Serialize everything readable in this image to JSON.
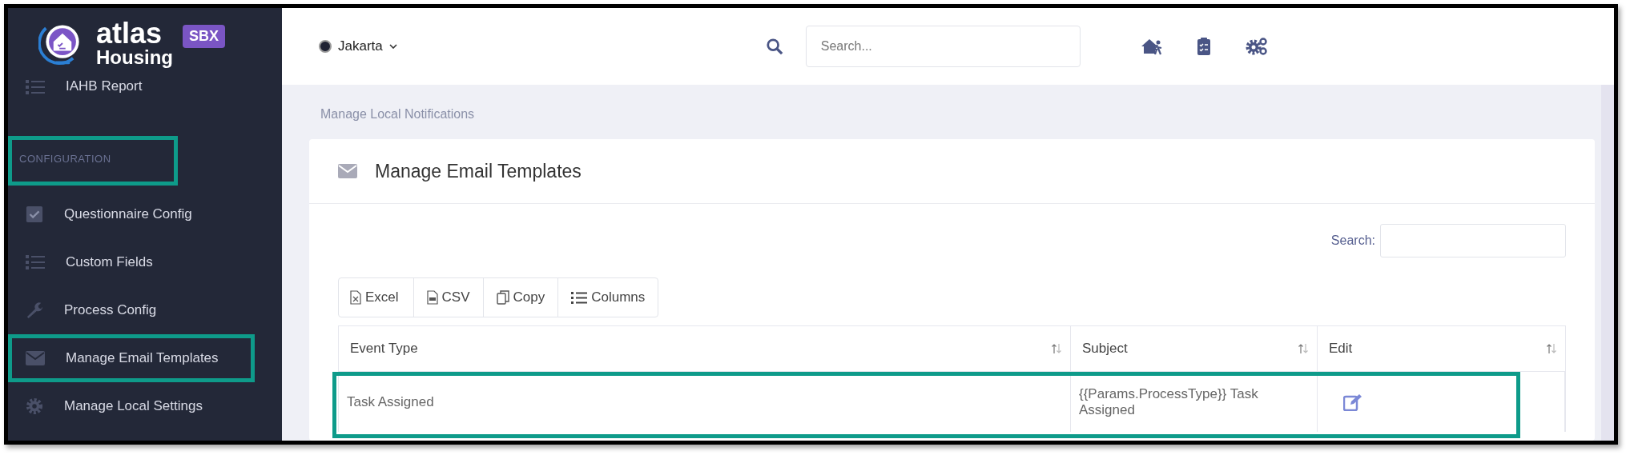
{
  "brand": {
    "name": "atlas",
    "sub": "Housing",
    "badge": "SBX"
  },
  "sidebar": {
    "items": [
      {
        "label": "IAHB Report",
        "kind": "list",
        "highlighted": false
      }
    ],
    "section": {
      "label": "CONFIGURATION",
      "highlighted": true
    },
    "config_items": [
      {
        "label": "Questionnaire Config",
        "kind": "check",
        "highlighted": false
      },
      {
        "label": "Custom Fields",
        "kind": "list",
        "highlighted": false
      },
      {
        "label": "Process Config",
        "kind": "wrench",
        "highlighted": false
      },
      {
        "label": "Manage Email Templates",
        "kind": "mail",
        "highlighted": true
      },
      {
        "label": "Manage Local Settings",
        "kind": "gear",
        "highlighted": false
      }
    ]
  },
  "topbar": {
    "location": "Jakarta",
    "search": {
      "placeholder": "Search..."
    }
  },
  "breadcrumb": "Manage Local Notifications",
  "card": {
    "title": "Manage Email Templates",
    "search_label": "Search:",
    "buttons": [
      {
        "label": "Excel",
        "kind": "excel"
      },
      {
        "label": "CSV",
        "kind": "csv"
      },
      {
        "label": "Copy",
        "kind": "copy"
      },
      {
        "label": "Columns",
        "kind": "columns"
      }
    ],
    "table": {
      "columns": [
        "Event Type",
        "Subject",
        "Edit"
      ],
      "rows": [
        {
          "event_type": "Task Assigned",
          "subject": "{{Params.ProcessType}} Task Assigned",
          "highlighted": true
        }
      ]
    }
  }
}
